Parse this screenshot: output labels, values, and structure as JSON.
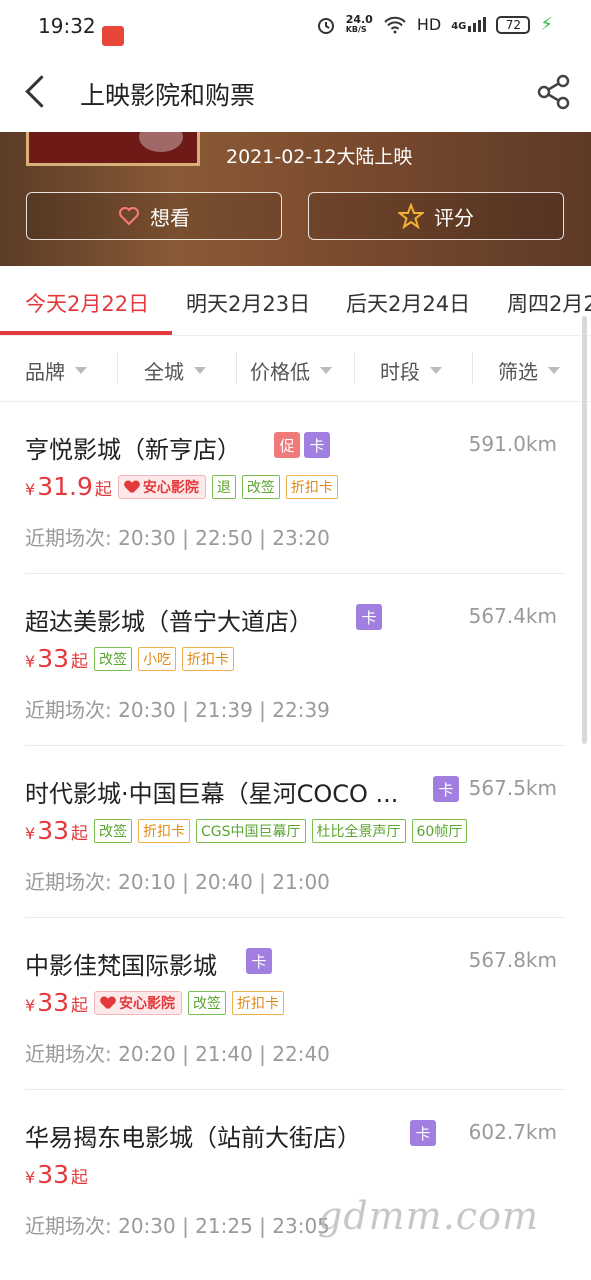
{
  "status_bar": {
    "time": "19:32",
    "net_speed": "24.0",
    "net_unit": "KB/S",
    "hd": "HD",
    "signal": "4G",
    "battery": "72"
  },
  "header": {
    "title": "上映影院和购票"
  },
  "movie": {
    "release": "2021-02-12大陆上映",
    "want_label": "想看",
    "rate_label": "评分"
  },
  "date_tabs": [
    {
      "label": "今天2月22日"
    },
    {
      "label": "明天2月23日"
    },
    {
      "label": "后天2月24日"
    },
    {
      "label": "周四2月2"
    }
  ],
  "filters": [
    {
      "label": "品牌"
    },
    {
      "label": "全城"
    },
    {
      "label": "价格低"
    },
    {
      "label": "时段"
    },
    {
      "label": "筛选"
    }
  ],
  "cinemas": [
    {
      "name": "亨悦影城（新亨店）",
      "badges": [
        "促",
        "卡"
      ],
      "distance": "591.0km",
      "currency": "¥",
      "price": "31.9",
      "price_suffix": "起",
      "safe_label": "安心影院",
      "tags": [
        "退",
        "改签",
        "折扣卡"
      ],
      "shows": "近期场次: 20:30 | 22:50 | 23:20"
    },
    {
      "name": "超达美影城（普宁大道店）",
      "badges": [
        "卡"
      ],
      "distance": "567.4km",
      "currency": "¥",
      "price": "33",
      "price_suffix": "起",
      "tags": [
        "改签",
        "小吃",
        "折扣卡"
      ],
      "shows": "近期场次: 20:30 | 21:39 | 22:39"
    },
    {
      "name": "时代影城·中国巨幕（星河COCO ...",
      "badges": [
        "卡"
      ],
      "distance": "567.5km",
      "currency": "¥",
      "price": "33",
      "price_suffix": "起",
      "tags": [
        "改签",
        "折扣卡",
        "CGS中国巨幕厅",
        "杜比全景声厅",
        "60帧厅"
      ],
      "shows": "近期场次: 20:10 | 20:40 | 21:00"
    },
    {
      "name": "中影佳梵国际影城",
      "badges": [
        "卡"
      ],
      "distance": "567.8km",
      "currency": "¥",
      "price": "33",
      "price_suffix": "起",
      "safe_label": "安心影院",
      "tags": [
        "改签",
        "折扣卡"
      ],
      "shows": "近期场次: 20:20 | 21:40 | 22:40"
    },
    {
      "name": "华易揭东电影城（站前大街店）",
      "badges": [
        "卡"
      ],
      "distance": "602.7km",
      "currency": "¥",
      "price": "33",
      "price_suffix": "起",
      "tags": [],
      "shows": "近期场次: 20:30 | 21:25 | 23:05"
    }
  ],
  "watermark": "gdmm.com",
  "colors": {
    "accent": "#e4393c",
    "card_badge": "#a07fe0",
    "promo_badge": "#f07a7a",
    "tag_green": "#5aa62e",
    "tag_orange": "#e08a17"
  }
}
